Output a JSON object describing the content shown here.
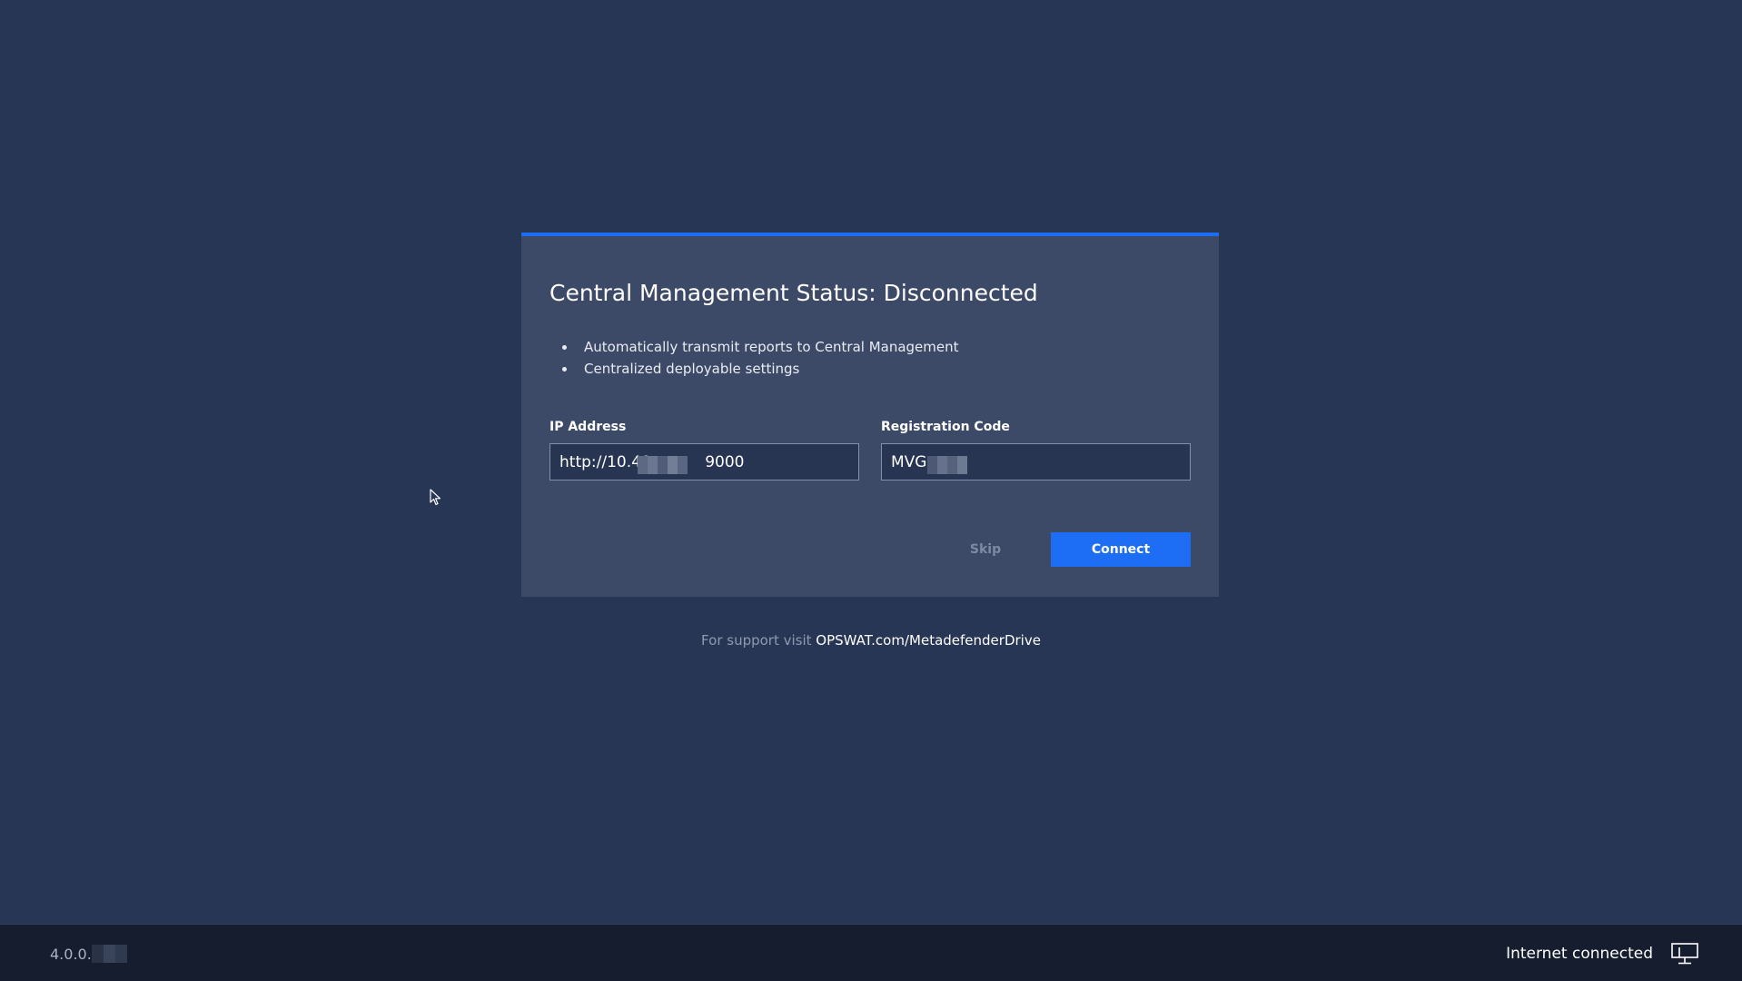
{
  "dialog": {
    "title": "Central Management Status: Disconnected",
    "bullets": [
      "Automatically transmit reports to Central Management",
      "Centralized deployable settings"
    ],
    "ip_field": {
      "label": "IP Address",
      "value": "http://10.40.          9000"
    },
    "registration_field": {
      "label": "Registration Code",
      "value": "MVG"
    },
    "skip_label": "Skip",
    "connect_label": "Connect"
  },
  "support": {
    "prefix": "For support visit ",
    "link_text": "OPSWAT.com/MetadefenderDrive"
  },
  "footer": {
    "version": "4.0.0.",
    "connection_status": "Internet connected",
    "status_icon": "monitor-icon"
  },
  "colors": {
    "background": "#283655",
    "dialog": "#3d4a67",
    "accent": "#1d6ef5",
    "footer": "#151d2e"
  }
}
